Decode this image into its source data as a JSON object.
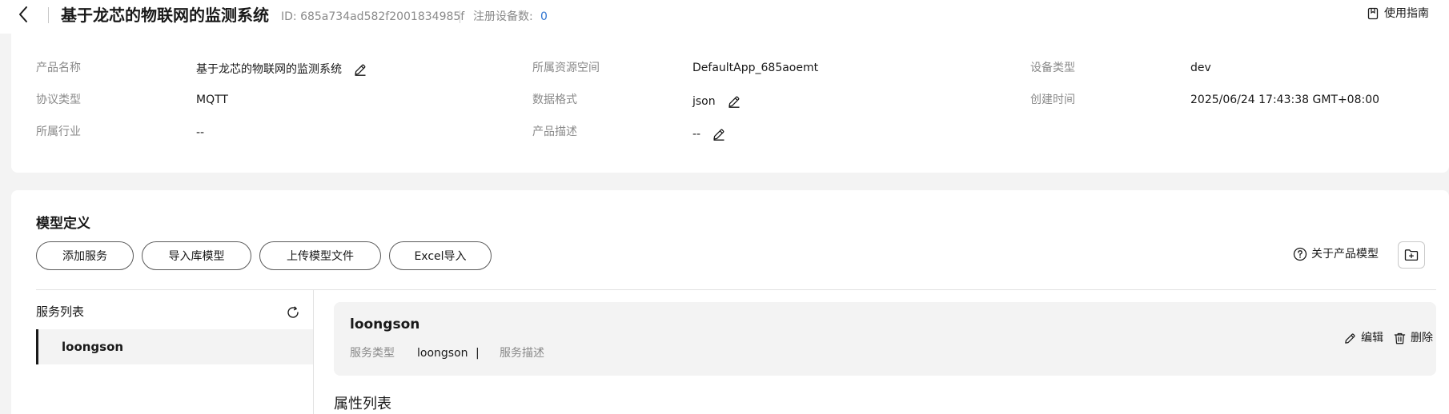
{
  "header": {
    "title": "基于龙芯的物联网的监测系统",
    "id_text": "ID: 685a734ad582f2001834985f",
    "registered_label": "注册设备数:",
    "registered_count": "0",
    "guide_label": "使用指南"
  },
  "info": {
    "fields": [
      {
        "label": "产品名称",
        "value": "基于龙芯的物联网的监测系统"
      },
      {
        "label": "所属资源空间",
        "value": "DefaultApp_685aoemt"
      },
      {
        "label": "设备类型",
        "value": "dev"
      },
      {
        "label": "协议类型",
        "value": "MQTT"
      },
      {
        "label": "数据格式",
        "value": "json"
      },
      {
        "label": "创建时间",
        "value": "2025/06/24 17:43:38 GMT+08:00"
      },
      {
        "label": "所属行业",
        "value": "--"
      },
      {
        "label": "产品描述",
        "value": "--"
      }
    ]
  },
  "model": {
    "title": "模型定义",
    "buttons": {
      "add_service": "添加服务",
      "import_library": "导入库模型",
      "upload_model": "上传模型文件",
      "excel_import": "Excel导入"
    },
    "about_label": "关于产品模型",
    "service_list_title": "服务列表",
    "services": [
      {
        "name": "loongson"
      }
    ],
    "detail": {
      "name": "loongson",
      "type_label": "服务类型",
      "type_value": "loongson",
      "separator": "|",
      "desc_label": "服务描述",
      "edit_label": "编辑",
      "delete_label": "删除"
    },
    "property_list_title": "属性列表"
  }
}
